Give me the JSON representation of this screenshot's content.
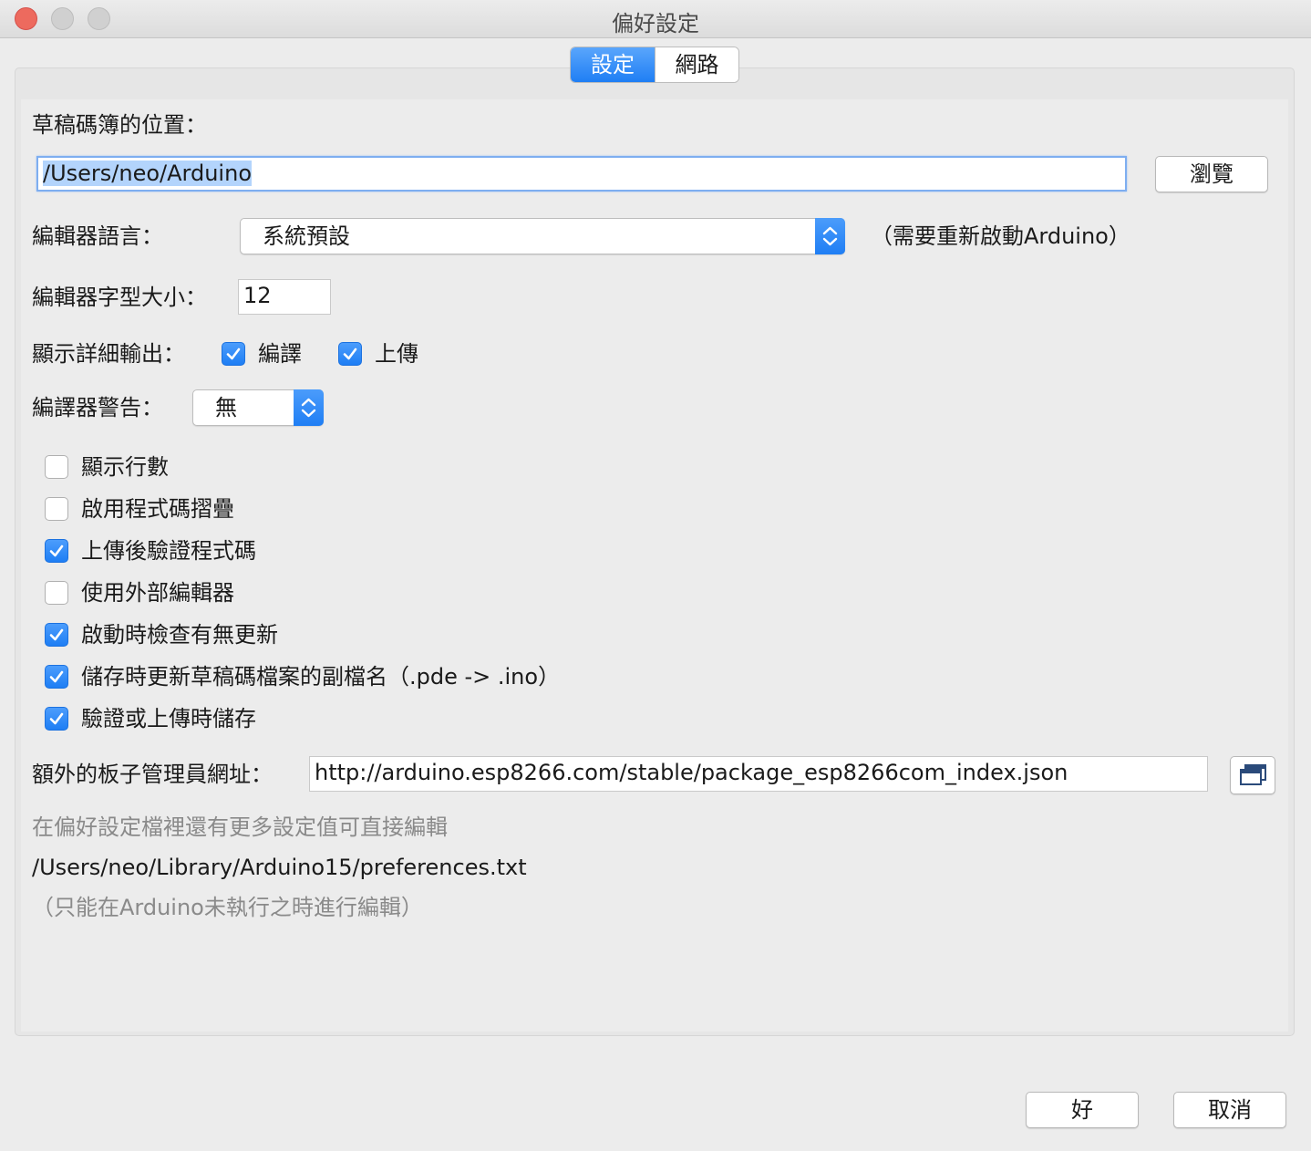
{
  "window": {
    "title": "偏好設定"
  },
  "tabs": [
    {
      "label": "設定",
      "active": true
    },
    {
      "label": "網路",
      "active": false
    }
  ],
  "sketchbook": {
    "label": "草稿碼簿的位置：",
    "value": "/Users/neo/Arduino",
    "browse_label": "瀏覽"
  },
  "editor_language": {
    "label": "編輯器語言：",
    "value": "系統預設",
    "note": "（需要重新啟動Arduino）"
  },
  "font_size": {
    "label": "編輯器字型大小：",
    "value": "12"
  },
  "verbose_output": {
    "label": "顯示詳細輸出：",
    "compile_label": "編譯",
    "compile_checked": true,
    "upload_label": "上傳",
    "upload_checked": true
  },
  "compiler_warnings": {
    "label": "編譯器警告：",
    "value": "無"
  },
  "options": [
    {
      "label": "顯示行數",
      "checked": false
    },
    {
      "label": "啟用程式碼摺疊",
      "checked": false
    },
    {
      "label": "上傳後驗證程式碼",
      "checked": true
    },
    {
      "label": "使用外部編輯器",
      "checked": false
    },
    {
      "label": "啟動時檢查有無更新",
      "checked": true
    },
    {
      "label": "儲存時更新草稿碼檔案的副檔名（.pde -> .ino）",
      "checked": true
    },
    {
      "label": "驗證或上傳時儲存",
      "checked": true
    }
  ],
  "board_manager": {
    "label": "額外的板子管理員網址：",
    "value": "http://arduino.esp8266.com/stable/package_esp8266com_index.json",
    "button_icon": "window-list-icon"
  },
  "info": {
    "more_text": "在偏好設定檔裡還有更多設定值可直接編輯",
    "path": "/Users/neo/Library/Arduino15/preferences.txt",
    "note": "（只能在Arduino未執行之時進行編輯）"
  },
  "footer": {
    "ok_label": "好",
    "cancel_label": "取消"
  },
  "colors": {
    "accent": "#1f7ef4",
    "close": "#ed6a5e",
    "selection": "#b3d4fc"
  }
}
